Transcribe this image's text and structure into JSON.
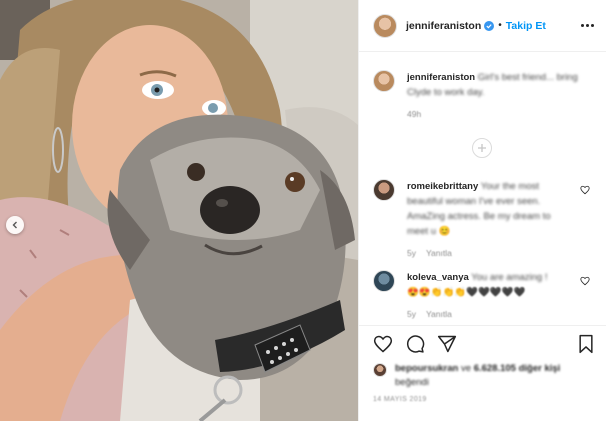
{
  "post": {
    "username": "jenniferaniston",
    "follow_label": "Takip Et",
    "caption": {
      "username": "jenniferaniston",
      "text": "Girl's best friend... bring Clyde to work day.",
      "age": "49h"
    },
    "comments": [
      {
        "username": "romeikebrittany",
        "text": "Your the most beautiful woman I've ever seen. AmaZing actress. Be my dream to meet u",
        "emoji": "😊",
        "age": "5y",
        "reply_label": "Yanıtla"
      },
      {
        "username": "koleva_vanya",
        "text": "You are amazing !",
        "emoji": "😍😍👏👏👏🖤🖤🖤🖤🖤",
        "age": "5y",
        "reply_label": "Yanıtla"
      }
    ],
    "likes": {
      "liker": "bepoursukran",
      "connector": "ve",
      "count": "6.628.105",
      "suffix": "diğer kişi",
      "suffix2": "beğendi"
    },
    "date": "14 MAYIS 2019"
  },
  "icons": {
    "verified": "verified-badge-icon",
    "more": "more-options-icon",
    "heart": "heart-icon",
    "comment": "comment-icon",
    "share": "share-icon",
    "save": "bookmark-icon",
    "load_more": "plus-circle-icon",
    "prev": "chevron-left-icon"
  },
  "colors": {
    "accent": "#0095f6",
    "text": "#262626",
    "muted": "#8e8e8e"
  }
}
